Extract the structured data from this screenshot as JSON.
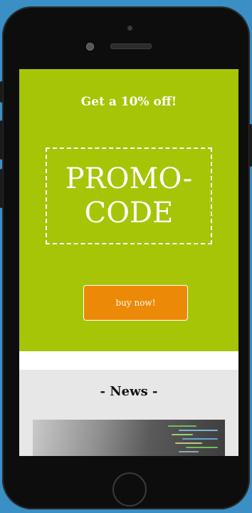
{
  "promo": {
    "title": "Get a 10% off!",
    "code_line1": "PROMO-",
    "code_line2": "CODE",
    "button_label": "buy now!"
  },
  "news": {
    "heading": "-  News  -",
    "image_icon": "code-screen-photo"
  },
  "colors": {
    "background": "#3a8fc4",
    "promo_bg": "#a6c506",
    "button_bg": "#ec8a08",
    "news_bg": "#e8e7e8"
  }
}
